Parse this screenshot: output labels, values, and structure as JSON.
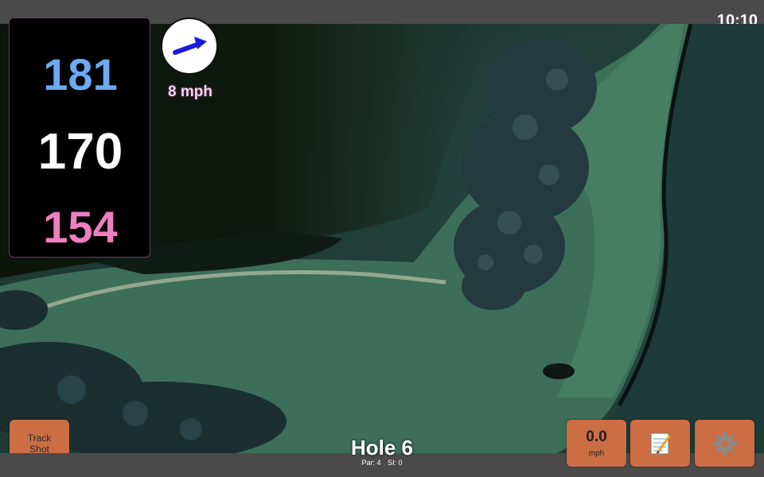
{
  "status_bar": {
    "time": "10:10"
  },
  "distances": {
    "back": "181",
    "middle": "170",
    "front": "154"
  },
  "wind": {
    "speed": "8 mph",
    "icon": "wind-direction-arrow-icon"
  },
  "hole": {
    "title": "Hole 6",
    "par": "Par: 4",
    "stroke_index": "SI: 0"
  },
  "buttons": {
    "track_shot_line1": "Track",
    "track_shot_line2": "Shot",
    "speed_value": "0.0",
    "speed_unit": "mph",
    "notes_icon": "notepad-icon",
    "settings_icon": "gear-icon"
  },
  "colors": {
    "back_distance": "#6aabf2",
    "middle_distance": "#ffffff",
    "front_distance": "#ef7fc0",
    "button": "#cc6d43"
  }
}
